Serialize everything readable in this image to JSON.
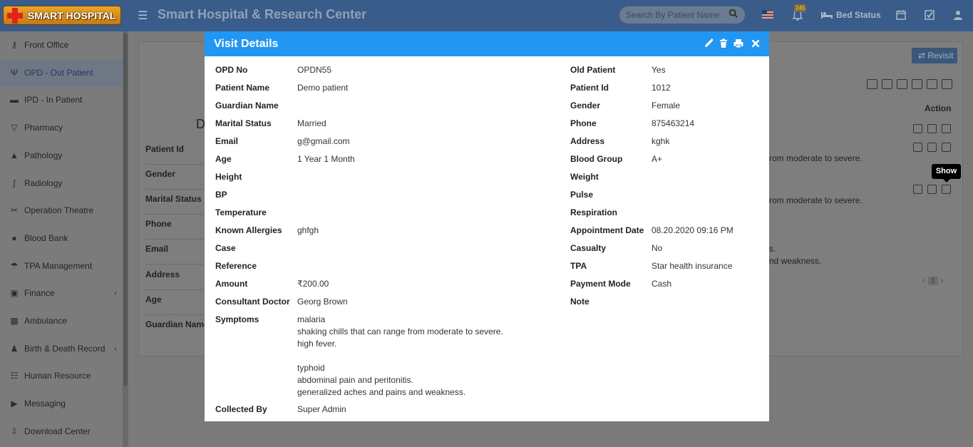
{
  "app": {
    "logo_text": "SMART HOSPITAL",
    "title": "Smart Hospital & Research Center",
    "search_placeholder": "Search By Patient Name",
    "notification_count": "245",
    "bed_status_label": "Bed Status"
  },
  "sidebar": {
    "items": [
      {
        "label": "Front Office",
        "icon": "front-office-icon"
      },
      {
        "label": "OPD - Out Patient",
        "icon": "stethoscope-icon",
        "active": true
      },
      {
        "label": "IPD - In Patient",
        "icon": "bed-icon"
      },
      {
        "label": "Pharmacy",
        "icon": "mortar-pestle-icon"
      },
      {
        "label": "Pathology",
        "icon": "flask-icon"
      },
      {
        "label": "Radiology",
        "icon": "microscope-icon"
      },
      {
        "label": "Operation Theatre",
        "icon": "scissors-icon"
      },
      {
        "label": "Blood Bank",
        "icon": "tint-icon"
      },
      {
        "label": "TPA Management",
        "icon": "umbrella-icon"
      },
      {
        "label": "Finance",
        "icon": "money-icon",
        "has_children": true
      },
      {
        "label": "Ambulance",
        "icon": "ambulance-icon"
      },
      {
        "label": "Birth & Death Record",
        "icon": "family-icon",
        "has_children": true
      },
      {
        "label": "Human Resource",
        "icon": "sitemap-icon"
      },
      {
        "label": "Messaging",
        "icon": "bullhorn-icon"
      },
      {
        "label": "Download Center",
        "icon": "download-icon"
      }
    ]
  },
  "background": {
    "labels": [
      "Patient Id",
      "Gender",
      "Marital Status",
      "Phone",
      "Email",
      "Address",
      "Age",
      "Guardian Name"
    ],
    "big_letter": "D",
    "revisit_label": "Revisit",
    "action_header": "Action",
    "row_texts": [
      "rom moderate to severe.",
      "rom moderate to severe.",
      "s.",
      "nd weakness."
    ],
    "tooltip": "Show",
    "page_number": "1",
    "pager_prev": "‹",
    "pager_next": "›"
  },
  "modal": {
    "title": "Visit Details",
    "left": [
      {
        "label": "OPD No",
        "value": "OPDN55"
      },
      {
        "label": "Patient Name",
        "value": "Demo patient"
      },
      {
        "label": "Guardian Name",
        "value": ""
      },
      {
        "label": "Marital Status",
        "value": "Married"
      },
      {
        "label": "Email",
        "value": "g@gmail.com"
      },
      {
        "label": "Age",
        "value": "1 Year 1 Month"
      },
      {
        "label": "Height",
        "value": ""
      },
      {
        "label": "BP",
        "value": ""
      },
      {
        "label": "Temperature",
        "value": ""
      },
      {
        "label": "Known Allergies",
        "value": "ghfgh"
      },
      {
        "label": "Case",
        "value": ""
      },
      {
        "label": "Reference",
        "value": ""
      },
      {
        "label": "Amount",
        "value": "₹200.00"
      },
      {
        "label": "Consultant Doctor",
        "value": "Georg Brown"
      }
    ],
    "right": [
      {
        "label": "Old Patient",
        "value": "Yes"
      },
      {
        "label": "Patient Id",
        "value": "1012"
      },
      {
        "label": "Gender",
        "value": "Female"
      },
      {
        "label": "Phone",
        "value": "875463214"
      },
      {
        "label": "Address",
        "value": "kghk"
      },
      {
        "label": "Blood Group",
        "value": "A+"
      },
      {
        "label": "Weight",
        "value": ""
      },
      {
        "label": "Pulse",
        "value": ""
      },
      {
        "label": "Respiration",
        "value": ""
      },
      {
        "label": "Appointment Date",
        "value": "08.20.2020 09:16 PM"
      },
      {
        "label": "Casualty",
        "value": "No"
      },
      {
        "label": "TPA",
        "value": "Star health insurance"
      },
      {
        "label": "Payment Mode",
        "value": "Cash"
      },
      {
        "label": "Note",
        "value": ""
      }
    ],
    "symptoms_label": "Symptoms",
    "symptoms_lines": [
      "malaria",
      "shaking chills that can range from moderate to severe.",
      "high fever.",
      "",
      "typhoid",
      "abdominal pain and peritonitis.",
      "generalized aches and pains and weakness."
    ],
    "collected_by_label": "Collected By",
    "collected_by_value": "Super Admin"
  }
}
